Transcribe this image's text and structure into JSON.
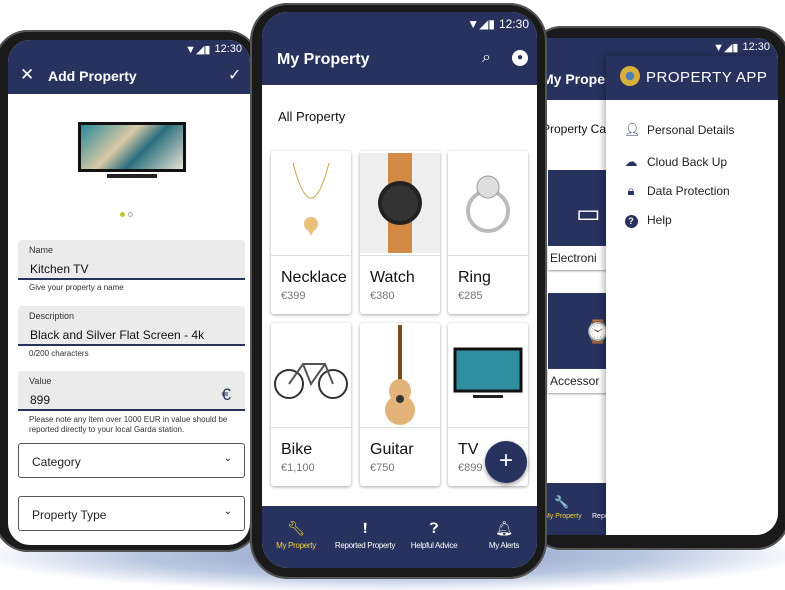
{
  "status": {
    "time": "12:30"
  },
  "colors": {
    "primary": "#27325e",
    "accent": "#f2d33a",
    "field_bg": "#ebebeb"
  },
  "add_property": {
    "title": "Add Property",
    "close_icon": "close-icon",
    "confirm_icon": "check-icon",
    "carousel": {
      "pages": 2,
      "active": 1
    },
    "name": {
      "label": "Name",
      "value": "Kitchen TV",
      "hint": "Give your property a name"
    },
    "description": {
      "label": "Description",
      "value": "Black and Silver Flat Screen - 4k",
      "hint": "0/200 characters"
    },
    "value": {
      "label": "Value",
      "value": "899",
      "currency": "€",
      "hint": "Please note any item over 1000 EUR in value should be reported directly to your local Garda station."
    },
    "category": {
      "label": "Category"
    },
    "property_type": {
      "label": "Property Type"
    }
  },
  "my_property": {
    "title": "My Property",
    "section": "All Property",
    "items": [
      {
        "name": "Necklace",
        "price": "€399"
      },
      {
        "name": "Watch",
        "price": "€380"
      },
      {
        "name": "Ring",
        "price": "€285"
      },
      {
        "name": "Bike",
        "price": "€1,100"
      },
      {
        "name": "Guitar",
        "price": "€750"
      },
      {
        "name": "TV",
        "price": "€899"
      }
    ],
    "fab": "+",
    "nav": [
      {
        "label": "My Property",
        "icon": "wrench-icon",
        "active": true
      },
      {
        "label": "Reported Property",
        "icon": "alert-icon"
      },
      {
        "label": "Helpful Advice",
        "icon": "help-icon"
      },
      {
        "label": "My Alerts",
        "icon": "bell-icon"
      }
    ]
  },
  "drawer_screen": {
    "behind_title": "My Proper",
    "behind_section": "Property Cate",
    "tiles": [
      "Electroni",
      "Accessor"
    ],
    "behind_nav": [
      "My Property",
      "Repo"
    ],
    "app_name": "PROPERTY APP",
    "items": [
      {
        "label": "Personal Details",
        "icon": "person-icon"
      },
      {
        "label": "Cloud Back Up",
        "icon": "cloud-upload-icon"
      },
      {
        "label": "Data Protection",
        "icon": "lock-icon"
      },
      {
        "label": "Help",
        "icon": "help-circle-icon"
      }
    ]
  }
}
